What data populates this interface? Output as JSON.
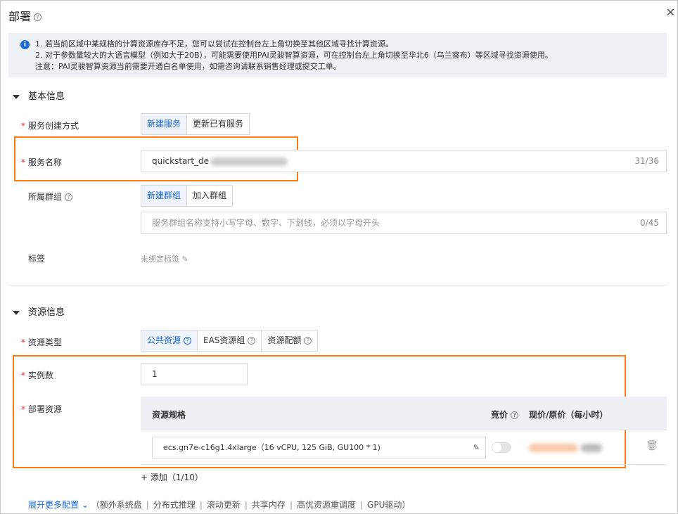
{
  "title": "部署",
  "info": [
    "1. 若当前区域中某规格的计算资源库存不足，您可以尝试在控制台左上角切换至其他区域寻找计算资源。",
    "2. 对于参数量较大的大语言模型（例如大于20B），可能需要使用PAI灵骏智算资源，可在控制台左上角切换至华北6（乌兰察布）等区域寻找资源使用。",
    "注意：PAI灵骏智算资源当前需要开通白名单使用，如需咨询请联系销售经理或提交工单。"
  ],
  "basic": {
    "section": "基本信息",
    "create_mode": {
      "label": "服务创建方式",
      "options": [
        "新建服务",
        "更新已有服务"
      ]
    },
    "service_name": {
      "label": "服务名称",
      "value": "quickstart_de",
      "count": "31/36"
    },
    "group": {
      "label": "所属群组",
      "options": [
        "新建群组",
        "加入群组"
      ],
      "placeholder": "服务群组名称支持小写字母、数字、下划线，必须以字母开头",
      "count": "0/45"
    },
    "tags": {
      "label": "标签",
      "value": "未绑定标签"
    }
  },
  "resource": {
    "section": "资源信息",
    "type": {
      "label": "资源类型",
      "options": [
        "公共资源",
        "EAS资源组",
        "资源配额"
      ]
    },
    "instances": {
      "label": "实例数",
      "value": "1"
    },
    "deploy": {
      "label": "部署资源",
      "col_spec": "资源规格",
      "col_bid": "竞价",
      "col_price": "现价/原价（每小时）",
      "spec": "ecs.gn7e-c16g1.4xlarge（16 vCPU, 125 GiB, GU100 * 1)",
      "bid_on": false
    },
    "add": "添加（1/10）"
  },
  "more": {
    "link": "展开更多配置",
    "items": [
      "额外系统盘",
      "分布式推理",
      "滚动更新",
      "共享内存",
      "高优资源重调度",
      "GPU驱动"
    ]
  },
  "required_mark": "*"
}
